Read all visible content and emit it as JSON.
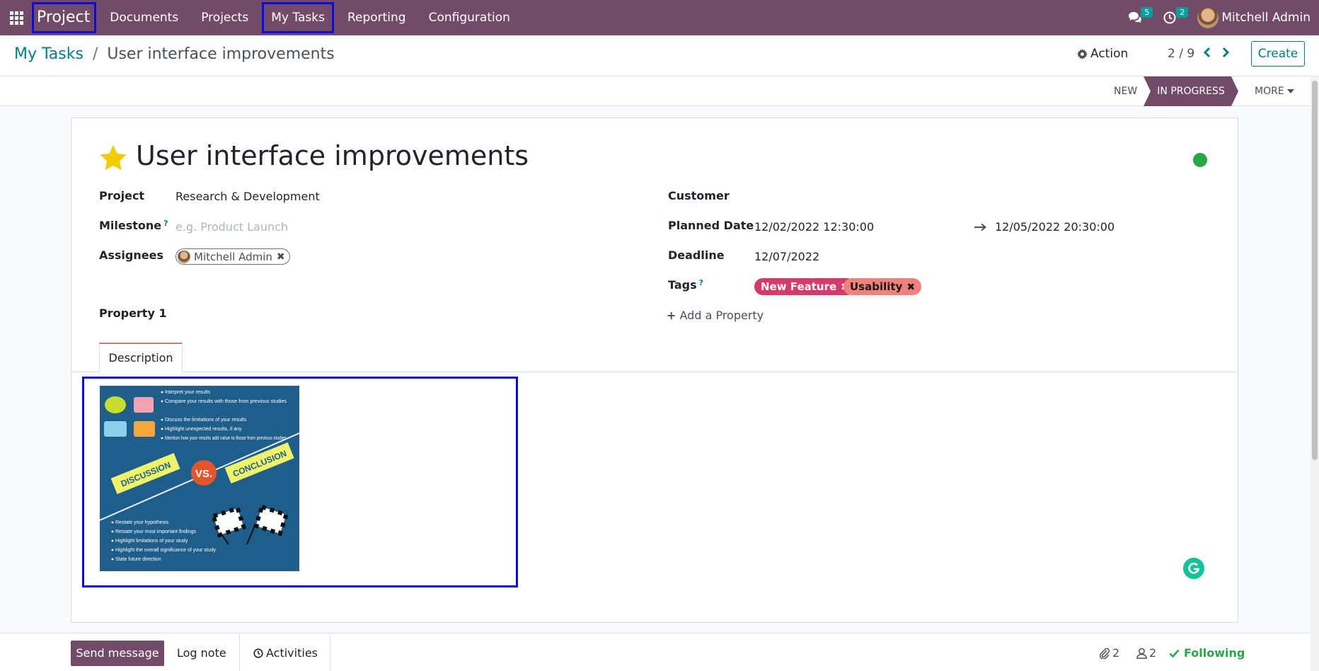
{
  "navbar": {
    "brand": "Project",
    "menu": [
      "Documents",
      "Projects",
      "My Tasks",
      "Reporting",
      "Configuration"
    ],
    "messages_count": "5",
    "activities_count": "2",
    "user_name": "Mitchell Admin"
  },
  "control_panel": {
    "breadcrumb_parent": "My Tasks",
    "breadcrumb_separator": "/",
    "breadcrumb_current": "User interface improvements",
    "action_label": "Action",
    "pager": "2 / 9",
    "create_label": "Create"
  },
  "statusbar": {
    "stages": [
      "New",
      "In Progress"
    ],
    "active_stage": "In Progress",
    "more_label": "More"
  },
  "form": {
    "title": "User interface improvements",
    "priority_starred": true,
    "kanban_state_color": "#28a745",
    "project_label": "Project",
    "project_value": "Research & Development",
    "milestone_label": "Milestone",
    "milestone_help": "?",
    "milestone_placeholder": "e.g. Product Launch",
    "assignees_label": "Assignees",
    "assignee_name": "Mitchell Admin",
    "customer_label": "Customer",
    "planned_date_label": "Planned Date",
    "planned_start": "12/02/2022 12:30:00",
    "planned_end": "12/05/2022 20:30:00",
    "deadline_label": "Deadline",
    "deadline_value": "12/07/2022",
    "tags_label": "Tags",
    "tags_help": "?",
    "tags": [
      {
        "name": "New Feature",
        "color": "#d63a6a"
      },
      {
        "name": "Usability",
        "color": "#f0817b"
      }
    ],
    "property_label": "Property 1",
    "add_property_label": "Add a Property",
    "tab_label": "Description"
  },
  "description_image": {
    "bullets_top": [
      "Interpret your results",
      "Compare your results with those from previous studies",
      "Discuss the limitations of your results",
      "Highlight unexpected results, if any",
      "Mention how your results add value to those from previous studies"
    ],
    "left_banner": "DISCUSSION",
    "vs_label": "VS.",
    "right_banner": "CONCLUSION",
    "bullets_bottom": [
      "Restate your hypothesis",
      "Restate your most important findings",
      "Highlight limitations of your study",
      "Highlight the overall significance of your study",
      "State future direction"
    ]
  },
  "chatter": {
    "send_message": "Send message",
    "log_note": "Log note",
    "activities": "Activities",
    "attachments_count": "2",
    "followers_count": "2",
    "following_label": "Following"
  },
  "colors": {
    "brand": "#714b67",
    "link": "#017e84",
    "success": "#28a745",
    "highlight_box": "#0a0ae6"
  }
}
